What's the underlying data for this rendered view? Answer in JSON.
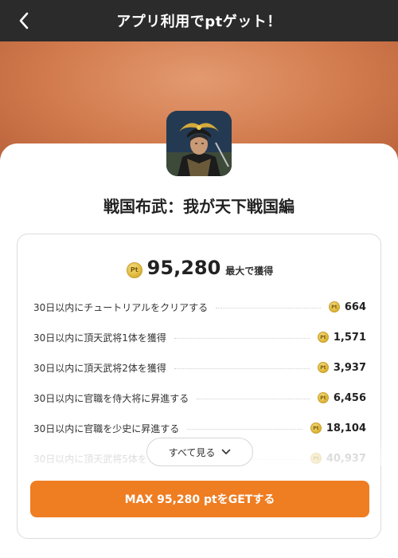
{
  "header": {
    "title": "アプリ利用でptゲット！"
  },
  "app": {
    "name": "戦国布武：我が天下戦国編"
  },
  "reward": {
    "coin_label": "Pt",
    "total_value": "95,280",
    "total_suffix": "最大で獲得"
  },
  "tasks": [
    {
      "label": "30日以内にチュートリアルをクリアする",
      "points": "664"
    },
    {
      "label": "30日以内に頂天武将1体を獲得",
      "points": "1,571"
    },
    {
      "label": "30日以内に頂天武将2体を獲得",
      "points": "3,937"
    },
    {
      "label": "30日以内に官職を侍大将に昇進する",
      "points": "6,456"
    },
    {
      "label": "30日以内に官職を少史に昇進する",
      "points": "18,104"
    },
    {
      "label": "30日以内に頂天武将5体を",
      "points": "40,937"
    }
  ],
  "see_all": {
    "label": "すべて見る"
  },
  "cta": {
    "label": "MAX 95,280 ptをGETする"
  },
  "colors": {
    "header_bg": "#2b2b2b",
    "hero_bg": "#d17a4d",
    "cta_bg": "#ef7d22",
    "coin": "#e0b93c"
  },
  "icons": {
    "back": "chevron-left-icon",
    "see_all": "chevron-down-icon",
    "coin": "pt-coin-icon"
  }
}
